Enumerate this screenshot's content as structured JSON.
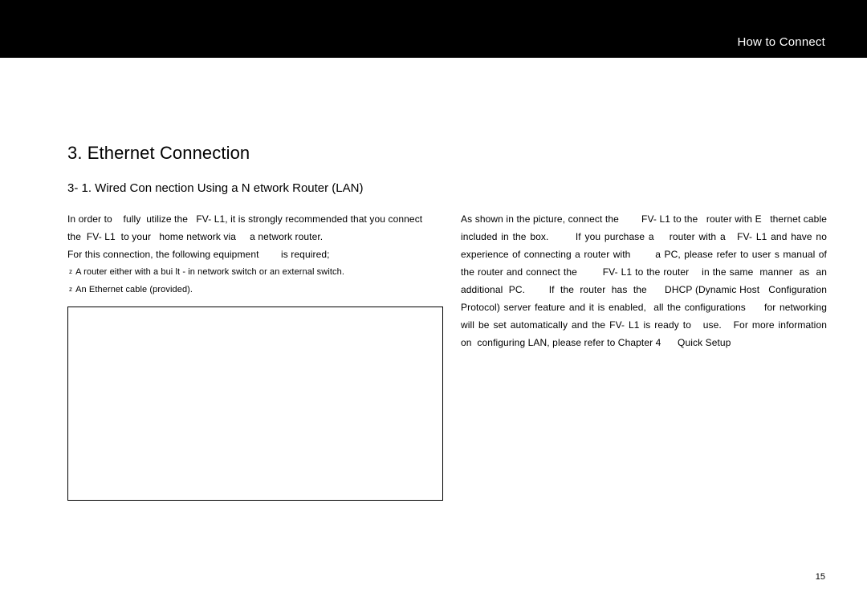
{
  "header": {
    "title": "How to Connect"
  },
  "chapter": {
    "title": "3.  Ethernet     Connection",
    "subtitle": "3- 1.  Wired Con    nection    Using a N   etwork     Router   (LAN)"
  },
  "left": {
    "para": "In order to    fully  utilize the   FV- L1, it is strongly recommended that you connect  the  FV- L1  to your   home network via     a network router.\nFor this connection, the following equipment        is required;",
    "bullet1": "A router either    with a bui  lt - in network switch     or an external switch.",
    "bullet2": "An  Ethernet cable    (provided)."
  },
  "right": {
    "para": "As shown in the picture, connect the        FV- L1 to the   router with E   thernet cable included in the box.       If you purchase a    router with a   FV- L1 and have no experience of connecting a router with       a PC, please refer to user s manual of the router and connect the        FV- L1 to the router    in the same  manner  as  an  additional  PC.        If  the  router  has  the      DHCP (Dynamic Host   Configuration Protocol) server feature and it is enabled,  all the configurations     for networking will be set automatically and the FV- L1 is ready to   use.   For more information     on  configuring LAN, please refer to Chapter 4      Quick Setup"
  },
  "page": {
    "number": "15"
  },
  "bullet_glyph": "z"
}
